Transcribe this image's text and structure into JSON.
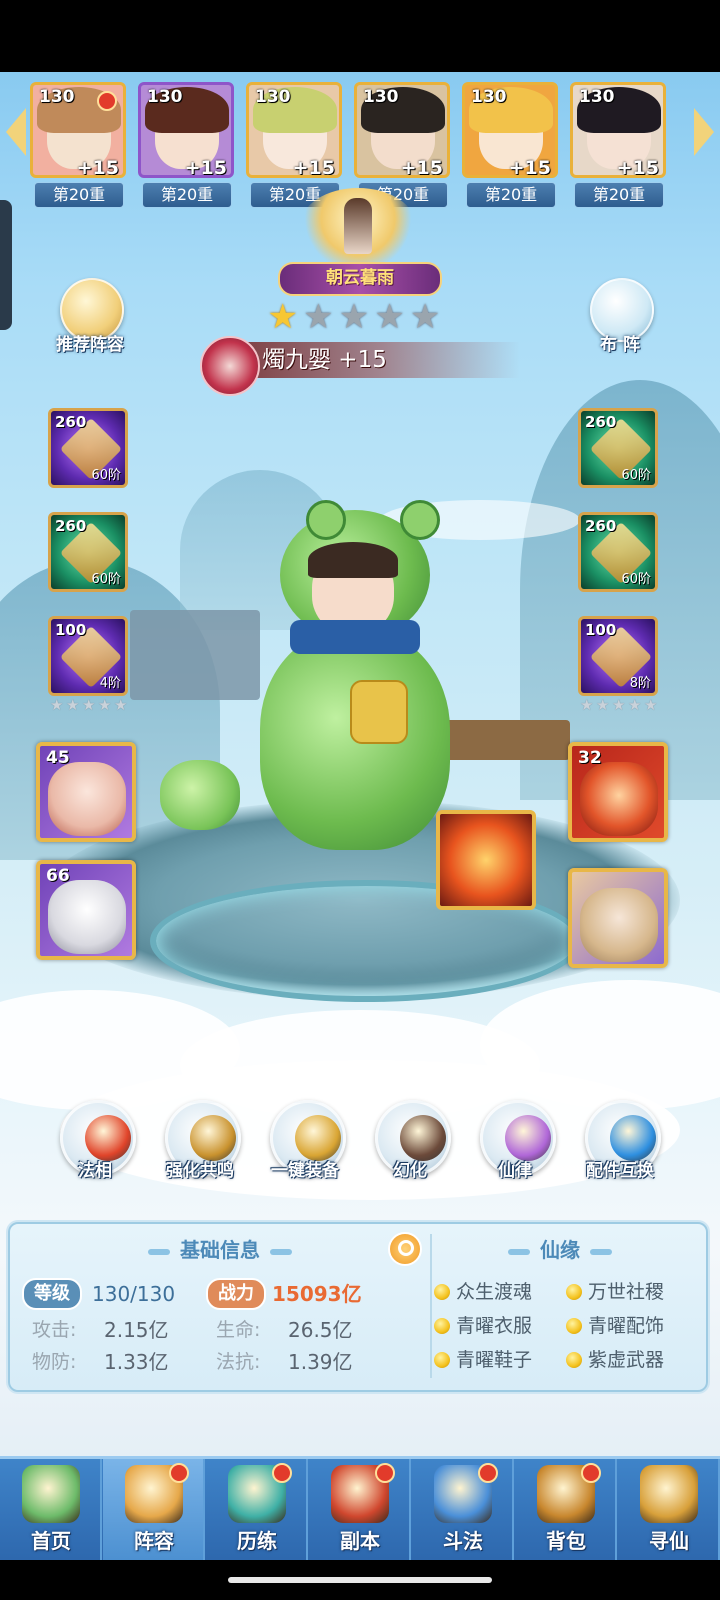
{
  "heroes": [
    {
      "level": "130",
      "plus": "+15",
      "tier": "第20重",
      "hair": "#c08a5a",
      "skin": "#f4e2cf",
      "frame": "#e9b13a",
      "bg": "#f2b0a0",
      "red_dot": true
    },
    {
      "level": "130",
      "plus": "+15",
      "tier": "第20重",
      "hair": "#5a2a1e",
      "skin": "#f6e0d0",
      "frame": "#8e55c9",
      "bg": "#b58bd6",
      "red_dot": false
    },
    {
      "level": "130",
      "plus": "+15",
      "tier": "第20重",
      "hair": "#c8d070",
      "skin": "#f8e8dc",
      "frame": "#e9b13a",
      "bg": "#e8c9a8",
      "red_dot": false
    },
    {
      "level": "130",
      "plus": "+15",
      "tier": "第20重",
      "hair": "#2a2420",
      "skin": "#f3ddcc",
      "frame": "#e9b13a",
      "bg": "#d9c3a0",
      "red_dot": false
    },
    {
      "level": "130",
      "plus": "+15",
      "tier": "第20重",
      "hair": "#f2c24a",
      "skin": "#f9e6d2",
      "frame": "#e9b13a",
      "bg": "#f0a640",
      "red_dot": false
    },
    {
      "level": "130",
      "plus": "+15",
      "tier": "第20重",
      "hair": "#1f1a22",
      "skin": "#f5e1d4",
      "frame": "#e9b13a",
      "bg": "#e7d8c8",
      "red_dot": false
    }
  ],
  "title_badge": "朝云暮雨",
  "stars": {
    "filled": 1,
    "total": 5
  },
  "hero_name": "燭九婴 +15",
  "side_buttons": {
    "recommend": "推荐阵容",
    "formation": "布 阵"
  },
  "equipment_left": [
    {
      "level": "260",
      "rank": "60阶",
      "color": "purple"
    },
    {
      "level": "260",
      "rank": "60阶",
      "color": "green"
    },
    {
      "level": "100",
      "rank": "4阶",
      "color": "purple"
    }
  ],
  "equipment_right": [
    {
      "level": "260",
      "rank": "60阶",
      "color": "green"
    },
    {
      "level": "260",
      "rank": "60阶",
      "color": "green"
    },
    {
      "level": "100",
      "rank": "8阶",
      "color": "purple"
    }
  ],
  "beasts_left": [
    {
      "level": "45"
    },
    {
      "level": "66"
    }
  ],
  "beasts_right": [
    {
      "level": "32"
    }
  ],
  "actions": [
    {
      "label": "法相",
      "color": "#e0442a"
    },
    {
      "label": "强化共鸣",
      "color": "#c9922e"
    },
    {
      "label": "一键装备",
      "color": "#d9a533"
    },
    {
      "label": "幻化",
      "color": "#6c4a3a"
    },
    {
      "label": "仙律",
      "color": "#b067d8"
    },
    {
      "label": "配件互换",
      "color": "#2e8fe0"
    }
  ],
  "info": {
    "basic_title": "基础信息",
    "level_label": "等级",
    "level_value": "130/130",
    "power_label": "战力",
    "power_value": "15093亿",
    "stats": [
      {
        "label": "攻击:",
        "value": "2.15亿"
      },
      {
        "label": "生命:",
        "value": "26.5亿"
      },
      {
        "label": "物防:",
        "value": "1.33亿"
      },
      {
        "label": "法抗:",
        "value": "1.39亿"
      }
    ],
    "fate_title": "仙缘",
    "fates": [
      "众生渡魂",
      "万世社稷",
      "青曜衣服",
      "青曜配饰",
      "青曜鞋子",
      "紫虚武器"
    ]
  },
  "nav": [
    {
      "label": "首页",
      "active": false,
      "red_dot": false,
      "color": "#6dbb6a"
    },
    {
      "label": "阵容",
      "active": true,
      "red_dot": true,
      "color": "#e6a84a"
    },
    {
      "label": "历练",
      "active": false,
      "red_dot": true,
      "color": "#3fb0a6"
    },
    {
      "label": "副本",
      "active": false,
      "red_dot": true,
      "color": "#d0472e"
    },
    {
      "label": "斗法",
      "active": false,
      "red_dot": true,
      "color": "#4a8fd8"
    },
    {
      "label": "背包",
      "active": false,
      "red_dot": true,
      "color": "#c8872e"
    },
    {
      "label": "寻仙",
      "active": false,
      "red_dot": false,
      "color": "#d8a03a"
    }
  ]
}
